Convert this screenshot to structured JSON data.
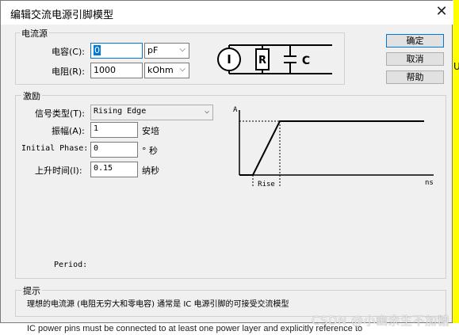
{
  "background": {
    "right_char": "U",
    "bottom_text": "IC power pins must be connected to at least one power layer and explicitly reference to",
    "watermark": "CSDN @小幽余生不加糖"
  },
  "dialog": {
    "title": "编辑交流电源引脚模型",
    "close_label": "✕",
    "source_group": {
      "label": "电流源",
      "capacitance_label": "电容(C):",
      "capacitance_value": "0",
      "capacitance_unit": "pF",
      "resistance_label": "电阻(R):",
      "resistance_value": "1000",
      "resistance_unit": "kOhm",
      "schematic": {
        "i_label": "I",
        "r_label": "R",
        "c_label": "C"
      }
    },
    "buttons": {
      "ok": "确定",
      "cancel": "取消",
      "help": "帮助"
    },
    "excitation_group": {
      "label": "激励",
      "signal_type_label": "信号类型(T):",
      "signal_type_value": "Rising Edge",
      "amplitude_label": "振幅(A):",
      "amplitude_value": "1",
      "amplitude_unit": "安培",
      "initial_phase_label": "Initial Phase:",
      "initial_phase_value": "0",
      "initial_phase_unit": "° 秒",
      "rise_time_label": "上升时间(I):",
      "rise_time_value": "0.15",
      "rise_time_unit": "纳秒",
      "period_label": "Period:",
      "waveform": {
        "y_label": "A",
        "x_label": "ns",
        "rise_label": "Rise"
      }
    },
    "hint_group": {
      "label": "提示",
      "text": "理想的电流源 (电阻无穷大和零电容) 通常是 IC 电源引脚的可接受交流模型"
    }
  },
  "colors": {
    "accent": "#0078d7",
    "dialog_bg": "#f0f0f0",
    "background": "#ffff00"
  }
}
